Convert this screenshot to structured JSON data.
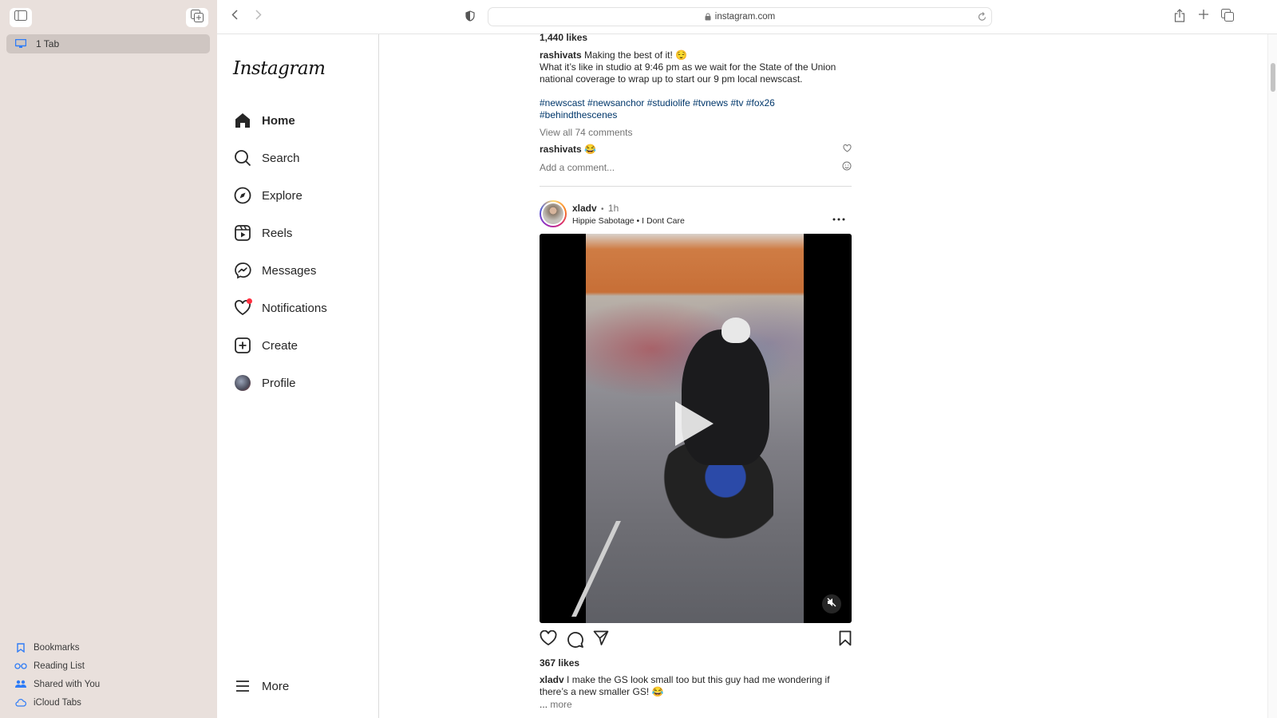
{
  "browser": {
    "sidebar": {
      "tab_group_label": "1 Tab",
      "links": [
        {
          "label": "Bookmarks",
          "icon": "bookmark-icon"
        },
        {
          "label": "Reading List",
          "icon": "reading-list-icon"
        },
        {
          "label": "Shared with You",
          "icon": "shared-with-you-icon"
        },
        {
          "label": "iCloud Tabs",
          "icon": "icloud-icon"
        }
      ],
      "accent_color": "#2f7cf6"
    },
    "url": "instagram.com"
  },
  "instagram": {
    "logo": "Instagram",
    "nav": [
      {
        "label": "Home",
        "icon": "home-icon",
        "active": true
      },
      {
        "label": "Search",
        "icon": "search-icon"
      },
      {
        "label": "Explore",
        "icon": "compass-icon"
      },
      {
        "label": "Reels",
        "icon": "reels-icon"
      },
      {
        "label": "Messages",
        "icon": "messenger-icon"
      },
      {
        "label": "Notifications",
        "icon": "heart-icon",
        "badge": true
      },
      {
        "label": "Create",
        "icon": "plus-square-icon"
      },
      {
        "label": "Profile",
        "icon": "avatar"
      }
    ],
    "more_label": "More",
    "notification_color": "#ff3040"
  },
  "feed": {
    "prev_post": {
      "likes": "1,440 likes",
      "username": "rashivats",
      "caption_first": "Making the best of it! 😌",
      "caption_body": "What it’s like in studio at 9:46 pm as we wait for the State of the Union national coverage to wrap up to start our 9 pm local newscast.",
      "hashtags_line1": "#newscast #newsanchor #studiolife #tvnews #tv #fox26",
      "hashtags_line2": "#behindthescenes",
      "view_comments": "View all 74 comments",
      "comment_user": "rashivats",
      "comment_text": "😂",
      "add_comment_placeholder": "Add a comment..."
    },
    "post": {
      "username": "xladv",
      "separator": "•",
      "time": "1h",
      "audio": "Hippie Sabotage • I Dont Care",
      "likes": "367 likes",
      "caption_user": "xladv",
      "caption": "I make the GS look small too but this guy had me wondering if there’s a new smaller GS! 😂",
      "more_prefix": "...",
      "more_label": "more"
    }
  }
}
